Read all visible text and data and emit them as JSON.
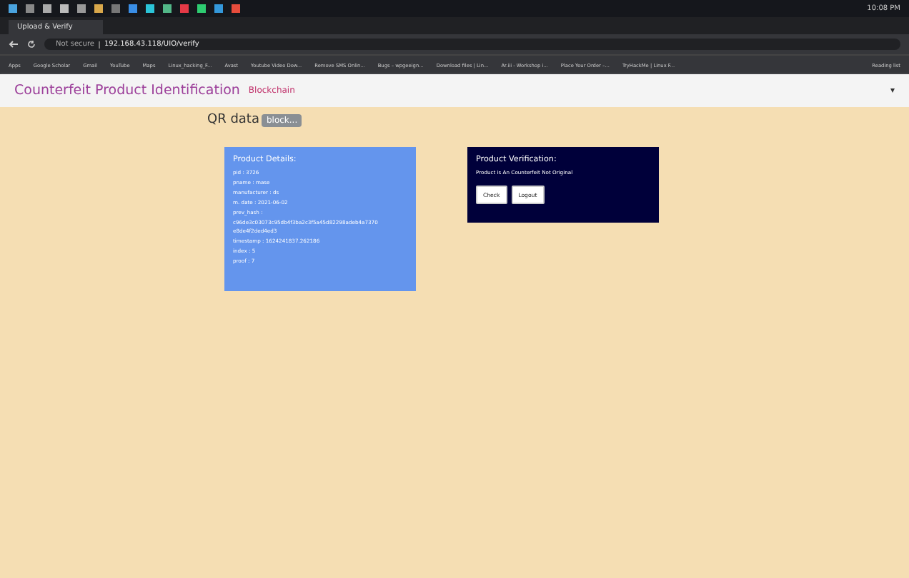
{
  "taskbar": {
    "clock": "10:08 PM"
  },
  "browser": {
    "tab_title": "Upload & Verify",
    "address_warning": "Not secure",
    "address": "192.168.43.118/UIO/verify",
    "bookmarks": [
      "Apps",
      "Google Scholar",
      "Gmail",
      "YouTube",
      "Maps",
      "Linux_hacking_F...",
      "Avast",
      "Youtube Video Dow...",
      "Remove SMS Onlin...",
      "Bugs – wpgeeign...",
      "Download files | Lin...",
      "Ar.iii - Workshop i...",
      "Place Your Order –...",
      "TryHackMe | Linux F..."
    ],
    "reading_list": "Reading list"
  },
  "navbar": {
    "brand": "Counterfeit Product Identification",
    "subtitle": "Blockchain",
    "toggle": "▾"
  },
  "qr": {
    "label": "QR data",
    "value": "block..."
  },
  "details": {
    "title": "Product Details:",
    "lines": [
      "pid : 3726",
      "pname : mase",
      "manufacturer : ds",
      "m. date : 2021-06-02",
      "prev_hash :",
      "c96de3c03073c95db4f3ba2c3f5a45d82298adeb4a7370",
      "e8de4f2ded4ed3",
      "timestamp : 1624241837.262186",
      "index : 5",
      "proof : 7"
    ]
  },
  "verification": {
    "title": "Product Verification:",
    "message": "Product is An Counterfeit Not Original",
    "buttons": [
      "Check",
      "Logout"
    ]
  }
}
